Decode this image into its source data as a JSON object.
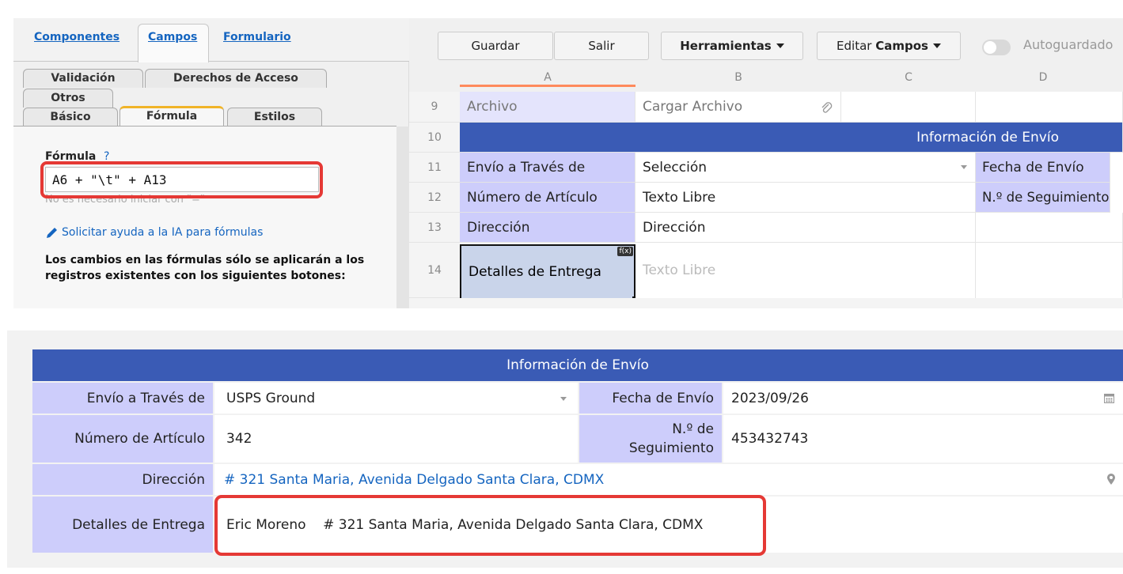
{
  "formula_panel": {
    "main_tabs": [
      "Componentes",
      "Campos",
      "Formulario"
    ],
    "subtabs_row1": [
      "Validación",
      "Derechos de Acceso"
    ],
    "subtabs_row2": [
      "Otros"
    ],
    "subtabs_row3": [
      "Básico",
      "Fórmula",
      "Estilos"
    ],
    "formula_label": "Fórmula",
    "help_mark": "?",
    "formula_value": "A6 + \"\\t\" + A13",
    "formula_hint": "No es necesario iniciar con \"=\"",
    "ai_link": "Solicitar ayuda a la IA para fórmulas",
    "note": "Los cambios en las fórmulas sólo se aplicarán a los registros existentes con los siguientes botones:"
  },
  "toolbar": {
    "save": "Guardar",
    "exit": "Salir",
    "tools": "Herramientas",
    "edit_prefix": "Editar",
    "edit_bold": "Campos",
    "autosave": "Autoguardado"
  },
  "columns": [
    "A",
    "B",
    "C",
    "D"
  ],
  "rows": [
    {
      "num": "9",
      "a": "Archivo",
      "b": "Cargar Archivo",
      "d": ""
    },
    {
      "num": "10",
      "header": "Información de Envío"
    },
    {
      "num": "11",
      "a": "Envío a Través de",
      "b": "Selección",
      "d": "Fecha de Envío"
    },
    {
      "num": "12",
      "a": "Número de Artículo",
      "b": "Texto Libre",
      "d": "N.º de Seguimiento"
    },
    {
      "num": "13",
      "a": "Dirección",
      "b": "Dirección",
      "d": ""
    },
    {
      "num": "14",
      "a": "Detalles de Entrega",
      "b": "Texto Libre",
      "formula_badge": "f(x)"
    }
  ],
  "form": {
    "header": "Información de Envío",
    "ship_via_label": "Envío a Través de",
    "ship_via_value": "USPS Ground",
    "ship_date_label": "Fecha de Envío",
    "ship_date_value": "2023/09/26",
    "item_label": "Número de Artículo",
    "item_value": "342",
    "tracking_label_1": "N.º de",
    "tracking_label_2": "Seguimiento",
    "tracking_value": "453432743",
    "address_label": "Dirección",
    "address_value": "# 321 Santa Maria, Avenida Delgado Santa Clara, CDMX",
    "delivery_label": "Detalles de Entrega",
    "delivery_value": "Eric Moreno    # 321 Santa Maria, Avenida Delgado Santa Clara, CDMX"
  },
  "colors": {
    "accent_blue": "#3a5bb5",
    "label_lavender": "#cdcdfb",
    "highlight_red": "#e53935",
    "link_blue": "#1565c0",
    "tab_orange": "#f0b428"
  }
}
